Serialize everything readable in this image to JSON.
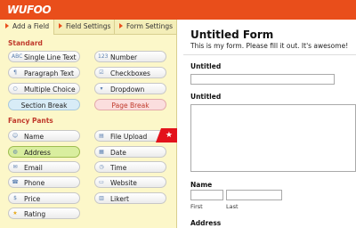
{
  "app": {
    "logo": "WUFOO"
  },
  "tabs": [
    {
      "label": "Add a Field"
    },
    {
      "label": "Field Settings"
    },
    {
      "label": "Form Settings"
    }
  ],
  "sidebar": {
    "standard_title": "Standard",
    "standard": [
      {
        "label": "Single Line Text",
        "icon": "abc-icon",
        "glyph": "ABC"
      },
      {
        "label": "Number",
        "icon": "number-icon",
        "glyph": "123"
      },
      {
        "label": "Paragraph Text",
        "icon": "paragraph-icon",
        "glyph": "¶"
      },
      {
        "label": "Checkboxes",
        "icon": "checkbox-icon",
        "glyph": "☑"
      },
      {
        "label": "Multiple Choice",
        "icon": "radio-icon",
        "glyph": "○"
      },
      {
        "label": "Dropdown",
        "icon": "dropdown-icon",
        "glyph": "▾"
      },
      {
        "label": "Section Break"
      },
      {
        "label": "Page Break"
      }
    ],
    "fancy_title": "Fancy Pants",
    "fancy": [
      {
        "label": "Name",
        "icon": "person-icon",
        "glyph": "☺"
      },
      {
        "label": "File Upload",
        "icon": "file-icon",
        "glyph": "▤"
      },
      {
        "label": "Address",
        "icon": "globe-icon",
        "glyph": "◍"
      },
      {
        "label": "Date",
        "icon": "calendar-icon",
        "glyph": "▦"
      },
      {
        "label": "Email",
        "icon": "email-icon",
        "glyph": "✉"
      },
      {
        "label": "Time",
        "icon": "clock-icon",
        "glyph": "◷"
      },
      {
        "label": "Phone",
        "icon": "phone-icon",
        "glyph": "☎"
      },
      {
        "label": "Website",
        "icon": "website-icon",
        "glyph": "▭"
      },
      {
        "label": "Price",
        "icon": "price-icon",
        "glyph": "$"
      },
      {
        "label": "Likert",
        "icon": "likert-icon",
        "glyph": "▥"
      },
      {
        "label": "Rating",
        "icon": "star-icon",
        "glyph": "★"
      }
    ],
    "new_badge": "★"
  },
  "form": {
    "title": "Untitled Form",
    "description": "This is my form. Please fill it out. It's awesome!",
    "fields": [
      {
        "label": "Untitled"
      },
      {
        "label": "Untitled"
      },
      {
        "label": "Name",
        "sub": [
          "First",
          "Last"
        ]
      },
      {
        "label": "Address"
      }
    ]
  },
  "colors": {
    "brand": "#e94e1b",
    "sidebar": "#fcf7c9",
    "accent_red": "#c0392b"
  }
}
